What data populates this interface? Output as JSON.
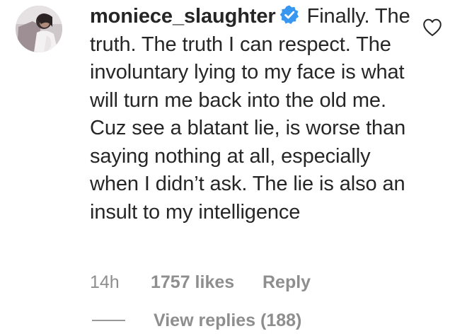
{
  "comment": {
    "username": "moniece_slaughter",
    "verified_icon": "verified-badge-icon",
    "text": "Finally. The truth. The truth I can respect. The involuntary lying to my face is what will turn me back into the old me. Cuz see a blatant lie, is worse than saying nothing at all, especially when I didn’t ask. The lie is also an insult to my intelligence",
    "like_icon": "heart-outline-icon",
    "time": "14h",
    "likes": "1757 likes",
    "reply_label": "Reply",
    "view_replies_label": "View replies (188)"
  },
  "colors": {
    "text": "#262626",
    "muted": "#8e8e8e",
    "verified": "#3897f0",
    "divider": "#999999"
  }
}
